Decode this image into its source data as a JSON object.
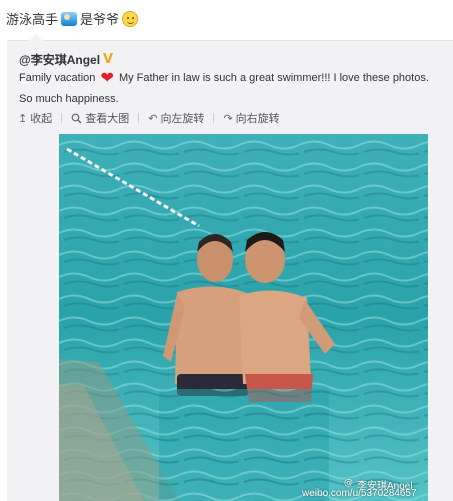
{
  "post": {
    "text_part1": "游泳高手",
    "text_part2": "是爷爷",
    "emoji_swim": "swimmer-emoji",
    "emoji_smile": "smile-emoji"
  },
  "repost": {
    "author": "@李安琪Angel",
    "verified_badge": "V",
    "caption_part1": "Family vacation ",
    "heart": "❤",
    "caption_part2": " My Father in law is such a great swimmer!!! I love these photos. So much happiness."
  },
  "toolbar": {
    "collapse_icon": "↥",
    "collapse_label": "收起",
    "view_large_icon": "🔍",
    "view_large_label": "查看大图",
    "rotate_left_icon": "↶",
    "rotate_left_label": "向左旋转",
    "rotate_right_icon": "↷",
    "rotate_right_label": "向右旋转"
  },
  "photo": {
    "watermark_logo": "@",
    "watermark_name": "李安琪Angel",
    "watermark_url": "weibo.com/u/5370284657"
  },
  "colors": {
    "pool_light": "#5fc2c9",
    "pool_dark": "#1f8e93",
    "skin": "#d9a07a",
    "shorts_dark": "#2a2a38",
    "shorts_red": "#c8574a",
    "accent_verified": "#f0a81a"
  }
}
